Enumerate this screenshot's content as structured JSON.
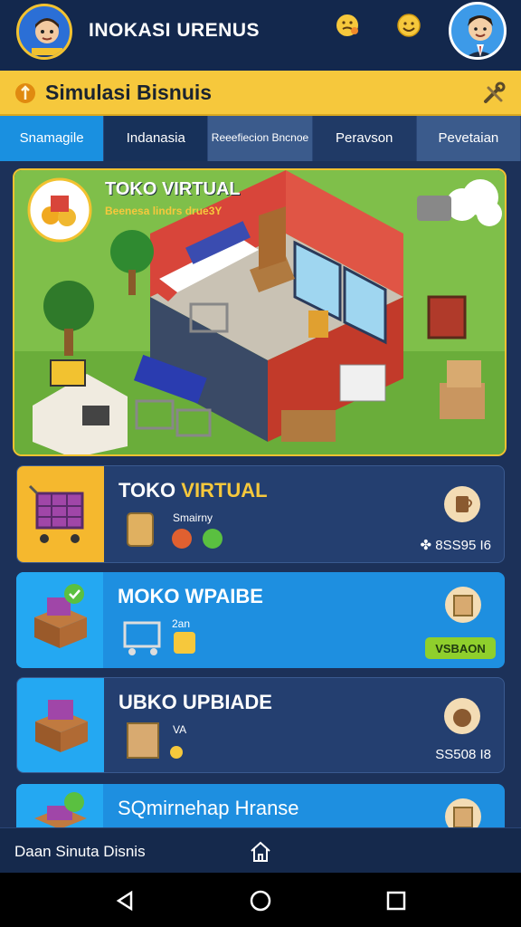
{
  "header": {
    "app_title": "INOKASI URENUS"
  },
  "banner": {
    "title": "Simulasi Bisnuis"
  },
  "tabs": [
    {
      "label": "Snamagile"
    },
    {
      "label": "Indanasia"
    },
    {
      "label": "Reeefiecion Bncnoe"
    },
    {
      "label": "Peravson"
    },
    {
      "label": "Pevetaian"
    }
  ],
  "hero": {
    "title": "TOKO VIRTUAL",
    "subtitle": "Beenesa lindrs drue3Y"
  },
  "cards": [
    {
      "title_a": "TOKO ",
      "title_b": "VIRTUAL",
      "meta": "Smairny",
      "value": "✤ 8SS95 I6"
    },
    {
      "title_a": "MOKO WPAIBE",
      "meta": "2an",
      "badge": "VSBAON"
    },
    {
      "title_a": "UBKO UPBIADE",
      "meta": "VA",
      "value": "SS508 I8"
    },
    {
      "title_a": "SQmirnehap Hranse"
    }
  ],
  "bottom_nav": {
    "label": "Daan Sinuta Disnis"
  },
  "colors": {
    "header_bg": "#13284d",
    "banner_bg": "#f6c83c",
    "active_tab": "#1a90e0",
    "card_blue": "#1e8fe0",
    "card_dark": "#243f70",
    "badge_green": "#8fcf2c"
  }
}
